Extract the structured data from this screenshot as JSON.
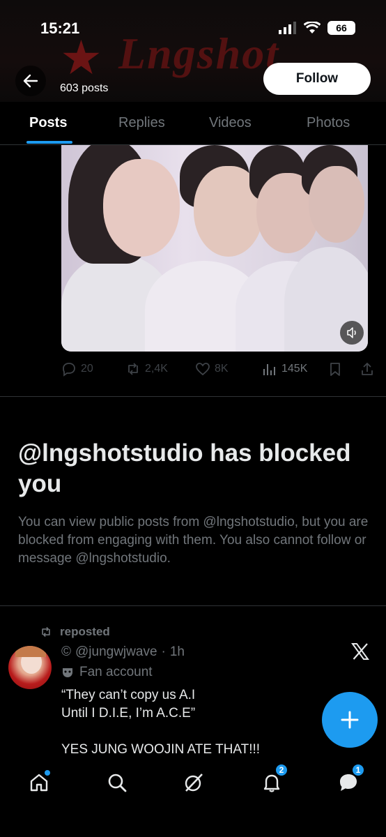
{
  "status_bar": {
    "time": "15:21",
    "battery": "66"
  },
  "header": {
    "banner_text": "Lngshot",
    "posts_count": "603 posts",
    "follow_label": "Follow"
  },
  "tabs": [
    {
      "label": "Posts",
      "active": true
    },
    {
      "label": "Replies",
      "active": false
    },
    {
      "label": "Videos",
      "active": false
    },
    {
      "label": "Photos",
      "active": false
    }
  ],
  "post": {
    "replies": "20",
    "reposts": "2,4K",
    "likes": "8K",
    "views": "145K"
  },
  "blocked": {
    "title": "@lngshotstudio has blocked you",
    "description": "You can view public posts from @lngshotstudio, but you are blocked from engaging with them. You also cannot follow or message @lngshotstudio."
  },
  "repost": {
    "label": "reposted",
    "handle": "@jungwjwave",
    "time": "1h",
    "account_label": "Fan account",
    "text": "“They can’t copy us A.I\nUntil I D.I.E, I’m A.C.E”\n\nYES JUNG WOOJIN ATE THAT!!!"
  },
  "bottom_nav": {
    "notifications_badge": "2",
    "messages_badge": "1"
  },
  "colors": {
    "accent": "#1d9bf0",
    "background": "#000000",
    "muted": "#71767b"
  }
}
